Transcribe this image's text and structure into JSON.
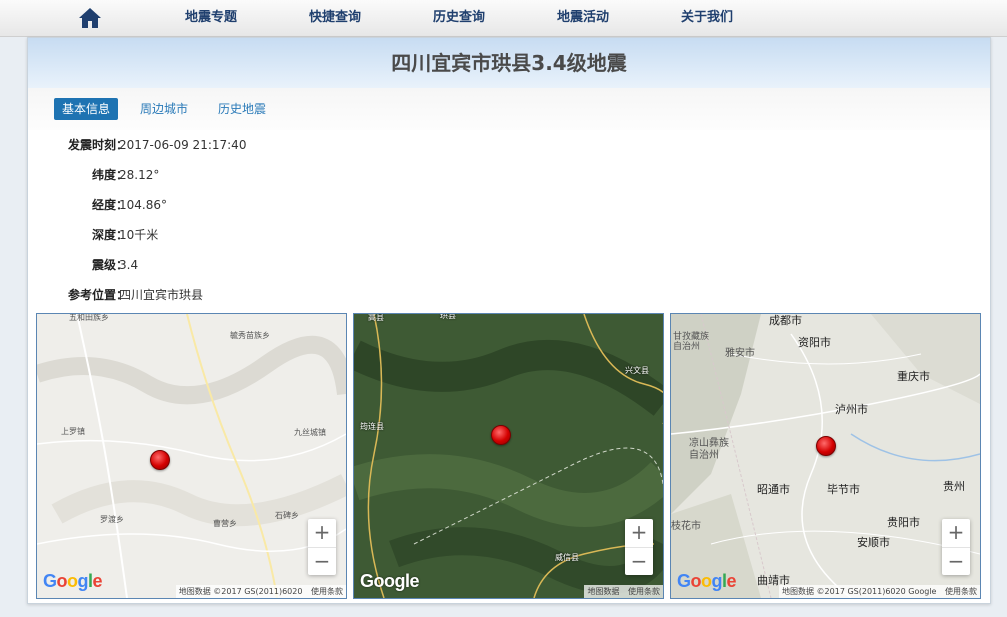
{
  "nav": {
    "home_label": "首页",
    "items": [
      "地震专题",
      "快捷查询",
      "历史查询",
      "地震活动",
      "关于我们"
    ]
  },
  "title": "四川宜宾市珙县3.4级地震",
  "tabs": [
    "基本信息",
    "周边城市",
    "历史地震"
  ],
  "info": [
    {
      "label": "发震时刻",
      "value": "2017-06-09 21:17:40"
    },
    {
      "label": "纬度",
      "value": "28.12°"
    },
    {
      "label": "经度",
      "value": "104.86°"
    },
    {
      "label": "深度",
      "value": "10千米"
    },
    {
      "label": "震级",
      "value": "3.4"
    },
    {
      "label": "参考位置",
      "value": "四川宜宾市珙县"
    }
  ],
  "maps": [
    {
      "kind": "roadmap",
      "places": [
        "五和田族乡",
        "毓秀苗族乡",
        "上罗镇",
        "九丝城镇",
        "罗渡乡",
        "曹营乡",
        "石碑乡"
      ],
      "logo": "Google",
      "attribution": {
        "data": "地图数据 ©2017 GS(2011)6020",
        "terms": "使用条款"
      }
    },
    {
      "kind": "satellite",
      "places": [
        "高县",
        "珙县",
        "兴文县",
        "筠连县",
        "威信县"
      ],
      "logo": "Google",
      "attribution": {
        "data": "地图数据",
        "terms": "使用条款"
      }
    },
    {
      "kind": "terrain",
      "places": [
        "成都市",
        "甘孜藏族自治州",
        "雅安市",
        "资阳市",
        "重庆市",
        "泸州市",
        "凉山彝族自治州",
        "昭通市",
        "毕节市",
        "贵州",
        "枝花市",
        "贵阳市",
        "安顺市",
        "曲靖市"
      ],
      "logo": "Google",
      "attribution": {
        "data": "地图数据 ©2017 GS(2011)6020 Google",
        "terms": "使用条款"
      }
    }
  ],
  "zoom": {
    "in": "+",
    "out": "−"
  },
  "colors": {
    "accent": "#1e73b2",
    "nav_text": "#1f3f6e",
    "marker": "#d40000"
  }
}
